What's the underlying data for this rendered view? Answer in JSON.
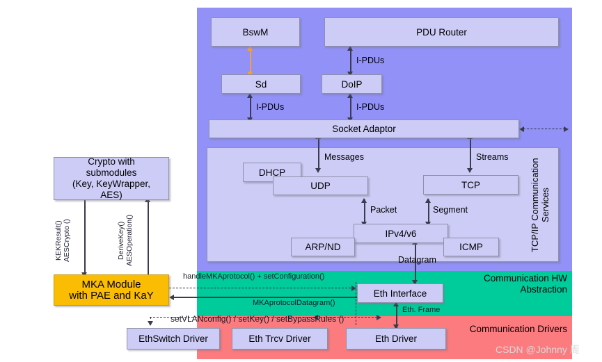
{
  "diagram": {
    "title": "AUTOSAR Ethernet Communication Stack with MACsec / MKA Module",
    "colors": {
      "bsw_band": "#9191F7",
      "hw_abstraction_band": "#00CC9B",
      "drivers_band": "#FB7B7F",
      "module_box": "#CCCCF7",
      "mka_module": "#FBBC04",
      "connector": "#3B3B4F",
      "orange_connector": "#F8A02C"
    }
  },
  "bands": {
    "hw_abstraction_label": "Communication HW\nAbstraction",
    "drivers_label": "Communication Drivers"
  },
  "groups": {
    "tcpip_services_label": "TCP/IP Communication\nServices"
  },
  "boxes": {
    "bswm": "BswM",
    "pdu_router": "PDU Router",
    "sd": "Sd",
    "doip": "DoIP",
    "socket_adaptor": "Socket Adaptor",
    "dhcp": "DHCP",
    "udp": "UDP",
    "tcp": "TCP",
    "arp_nd": "ARP/ND",
    "ipv4_v6": "IPv4/v6",
    "icmp": "ICMP",
    "crypto": "Crypto with\nsubmodules\n(Key, KeyWrapper,\nAES)",
    "mka_module": "MKA Module\nwith PAE and KaY",
    "eth_interface": "Eth Interface",
    "ethswitch_driver": "EthSwitch Driver",
    "eth_trcv_driver": "Eth Trcv Driver",
    "eth_driver": "Eth Driver"
  },
  "edge_labels": {
    "ipdus_pdurouter_doip": "I-PDUs",
    "ipdus_sd_soad": "I-PDUs",
    "ipdus_doip_soad": "I-PDUs",
    "messages": "Messages",
    "streams": "Streams",
    "packet": "Packet",
    "segment": "Segment",
    "datagram": "Datagram",
    "eth_frame": "Eth. Frame",
    "kek_aescrypto": "KEKResult()\nAESCrypto ()",
    "derivekey_aesoperation": "DeriveKey()\nAESOperation()",
    "handle_mka_protocol": "handleMKAprotocol() + setConfiguration()",
    "mka_protocol_datagram": "MKAprotocolDatagram()",
    "set_vlan_key_bypass": "setVLANconfig() / setKey() / setBypassRules ()"
  },
  "watermark": {
    "text": "CSDN @Johnny 周"
  }
}
